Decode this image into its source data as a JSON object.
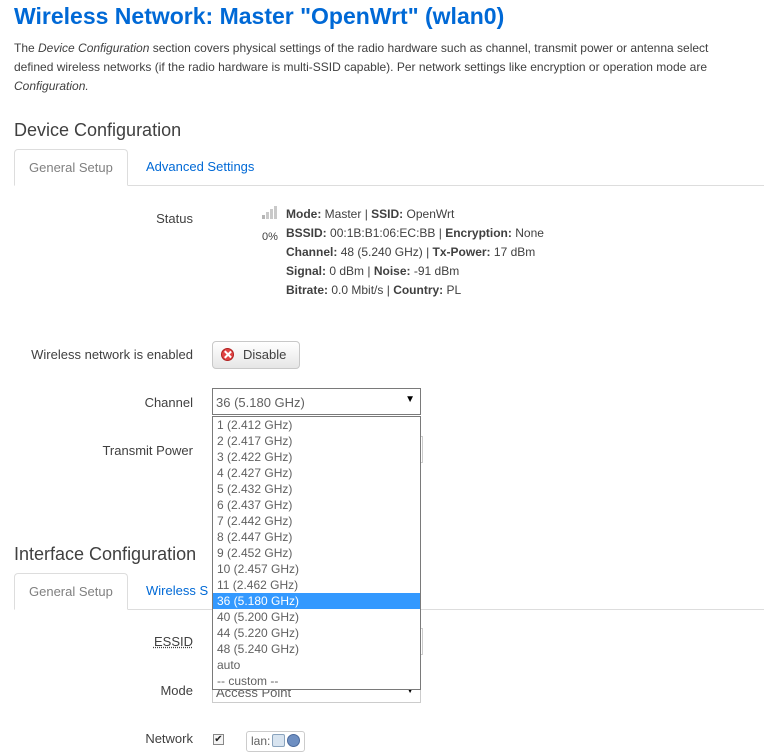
{
  "page": {
    "title": "Wireless Network: Master \"OpenWrt\" (wlan0)",
    "description": {
      "line1_pre": "The ",
      "line1_em": "Device Configuration",
      "line1_post": " section covers physical settings of the radio hardware such as channel, transmit power or antenna select",
      "line2": "defined wireless networks (if the radio hardware is multi-SSID capable). Per network settings like encryption or operation mode are",
      "line3_em": "Configuration."
    }
  },
  "device_config": {
    "title": "Device Configuration",
    "tabs": [
      "General Setup",
      "Advanced Settings"
    ],
    "status": {
      "label": "Status",
      "signal_percent": "0%",
      "mode_label": "Mode:",
      "mode": "Master",
      "ssid_label": "SSID:",
      "ssid": "OpenWrt",
      "bssid_label": "BSSID:",
      "bssid": "00:1B:B1:06:EC:BB",
      "encryption_label": "Encryption:",
      "encryption": "None",
      "channel_label": "Channel:",
      "channel": "48 (5.240 GHz)",
      "txpower_label": "Tx-Power:",
      "txpower": "17 dBm",
      "signal_label": "Signal:",
      "signal": "0 dBm",
      "noise_label": "Noise:",
      "noise": "-91 dBm",
      "bitrate_label": "Bitrate:",
      "bitrate": "0.0 Mbit/s",
      "country_label": "Country:",
      "country": "PL"
    },
    "enabled": {
      "label": "Wireless network is enabled",
      "button": "Disable"
    },
    "channel": {
      "label": "Channel",
      "selected": "36 (5.180 GHz)",
      "options": [
        "1 (2.412 GHz)",
        "2 (2.417 GHz)",
        "3 (2.422 GHz)",
        "4 (2.427 GHz)",
        "5 (2.432 GHz)",
        "6 (2.437 GHz)",
        "7 (2.442 GHz)",
        "8 (2.447 GHz)",
        "9 (2.452 GHz)",
        "10 (2.457 GHz)",
        "11 (2.462 GHz)",
        "36 (5.180 GHz)",
        "40 (5.200 GHz)",
        "44 (5.220 GHz)",
        "48 (5.240 GHz)",
        "auto",
        "-- custom --"
      ]
    },
    "transmit_power": {
      "label": "Transmit Power"
    }
  },
  "interface_config": {
    "title": "Interface Configuration",
    "tabs": [
      "General Setup",
      "Wireless S"
    ],
    "essid_label": "ESSID",
    "mode_label": "Mode",
    "mode_value": "Access Point",
    "network_label": "Network",
    "network_checked": true,
    "network_name": "lan:"
  },
  "colors": {
    "accent": "#0069d6",
    "selected": "#3399ff",
    "danger": "#e04343"
  }
}
